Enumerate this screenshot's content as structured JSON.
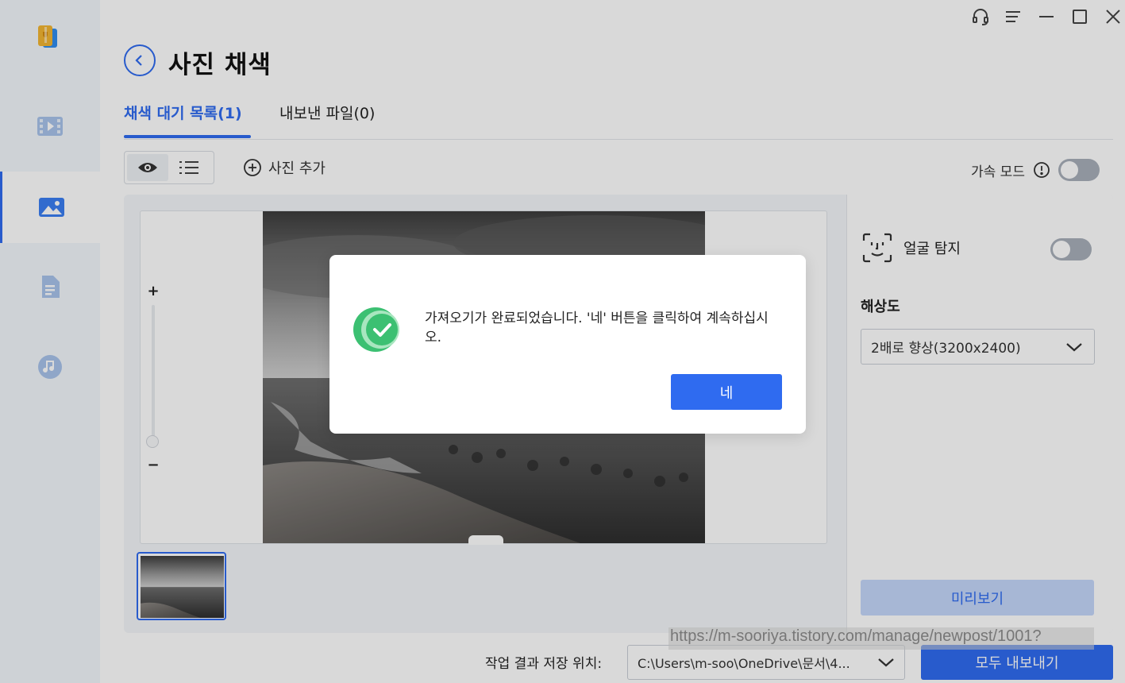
{
  "page": {
    "title": "사진 채색"
  },
  "tabs": [
    {
      "label": "채색 대기 목록(1)",
      "active": true
    },
    {
      "label": "내보낸 파일(0)",
      "active": false
    }
  ],
  "toolbar": {
    "add_photo_label": "사진 추가",
    "accel_mode_label": "가속 모드",
    "accel_mode_on": false
  },
  "preview": {
    "zoom_in_label": "+",
    "zoom_out_label": "−"
  },
  "settings": {
    "face_detect_label": "얼굴 탐지",
    "face_detect_on": false,
    "resolution_label": "해상도",
    "resolution_value": "2배로 향상(3200x2400)",
    "preview_button": "미리보기"
  },
  "footer": {
    "save_location_label": "작업 결과 저장 위치:",
    "save_path": "C:\\Users\\m-soo\\OneDrive\\문서\\4...",
    "export_all_button": "모두 내보내기"
  },
  "watermark": {
    "text": "https://m-sooriya.tistory.com/manage/newpost/1001?"
  },
  "dialog": {
    "message": "가져오기가 완료되었습니다. '네' 버튼을 클릭하여 계속하십시오.",
    "ok_button": "네"
  },
  "colors": {
    "accent": "#2f6bf0",
    "sidebar_bg": "#f3f7fc",
    "success": "#3cc072"
  },
  "icons": {
    "sidebar": [
      "app-logo-icon",
      "video-icon",
      "image-icon",
      "document-icon",
      "music-icon"
    ],
    "window": [
      "headset-icon",
      "menu-icon",
      "minimize-icon",
      "maximize-icon",
      "close-icon"
    ]
  }
}
